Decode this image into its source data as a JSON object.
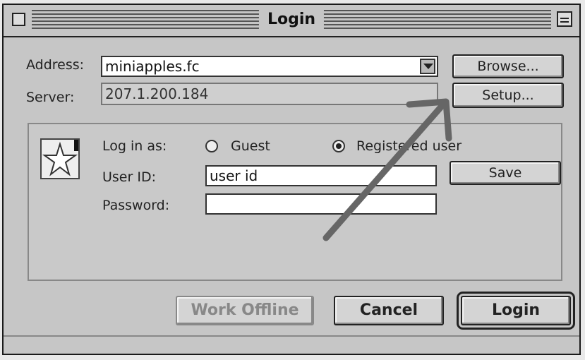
{
  "window": {
    "title": "Login"
  },
  "address": {
    "label": "Address:",
    "value": "miniapples.fc"
  },
  "server": {
    "label": "Server:",
    "value": "207.1.200.184"
  },
  "buttons": {
    "browse": "Browse...",
    "setup": "Setup...",
    "save": "Save",
    "work_offline": "Work Offline",
    "cancel": "Cancel",
    "login": "Login"
  },
  "login_as": {
    "label": "Log in as:",
    "options": [
      "Guest",
      "Registered user"
    ],
    "selected": "Registered user"
  },
  "user_id": {
    "label": "User ID:",
    "value": "user id"
  },
  "password": {
    "label": "Password:",
    "value": ""
  },
  "icons": [
    "close-box",
    "zoom-box",
    "star-icon",
    "dropdown-arrow",
    "annotation-arrow"
  ]
}
